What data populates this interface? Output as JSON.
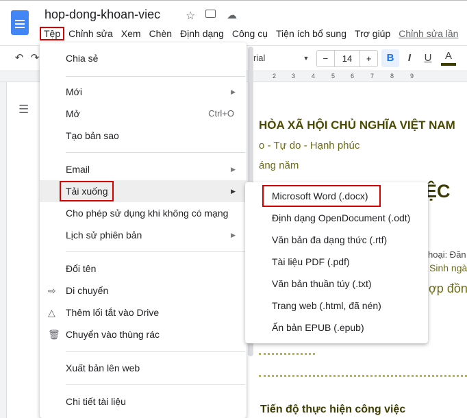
{
  "app": {
    "title": "hop-dong-khoan-viec",
    "last_edit": "Chỉnh sửa lần"
  },
  "menubar": [
    "Tệp",
    "Chỉnh sửa",
    "Xem",
    "Chèn",
    "Định dạng",
    "Công cụ",
    "Tiện ích bổ sung",
    "Trợ giúp"
  ],
  "toolbar": {
    "font": "rial",
    "font_size": "14",
    "minus": "−",
    "plus": "+",
    "bold": "B",
    "italic": "I",
    "underline": "U",
    "text_color": "A",
    "text_color_hex": "#3d3d00"
  },
  "ruler": [
    "2",
    "3",
    "4",
    "5",
    "6",
    "7",
    "8",
    "9"
  ],
  "file_menu": {
    "items": [
      {
        "label": "Chia sẻ"
      },
      {
        "label": "Mới"
      },
      {
        "label": "Mở",
        "shortcut": "Ctrl+O"
      },
      {
        "label": "Tạo bản sao"
      },
      {
        "label": "Email"
      },
      {
        "label": "Tải xuống"
      },
      {
        "label": "Cho phép sử dụng khi không có mạng"
      },
      {
        "label": "Lịch sử phiên bản"
      },
      {
        "label": "Đổi tên"
      },
      {
        "label": "Di chuyển"
      },
      {
        "label": "Thêm lối tắt vào Drive"
      },
      {
        "label": "Chuyển vào thùng rác"
      },
      {
        "label": "Xuất bản lên web"
      },
      {
        "label": "Chi tiết tài liệu"
      }
    ]
  },
  "download_menu": [
    "Microsoft Word (.docx)",
    "Định dạng OpenDocument (.odt)",
    "Văn bản đa dạng thức (.rtf)",
    "Tài liệu PDF (.pdf)",
    "Văn bản thuần túy (.txt)",
    "Trang web (.html, đã nén)",
    "Ấn bản EPUB (.epub)"
  ],
  "document": {
    "line1": "HÒA XÃ HỘI CHỦ NGHĨA VIỆT NAM",
    "line2": "o - Tự do - Hạnh phúc",
    "line3": "áng năm",
    "heading": "ỆC",
    "l4": "hoại: Đăn",
    "l5": "Sinh ngà",
    "l6": "ợp đồng",
    "section": "Tiến độ thực hiện công việc"
  }
}
